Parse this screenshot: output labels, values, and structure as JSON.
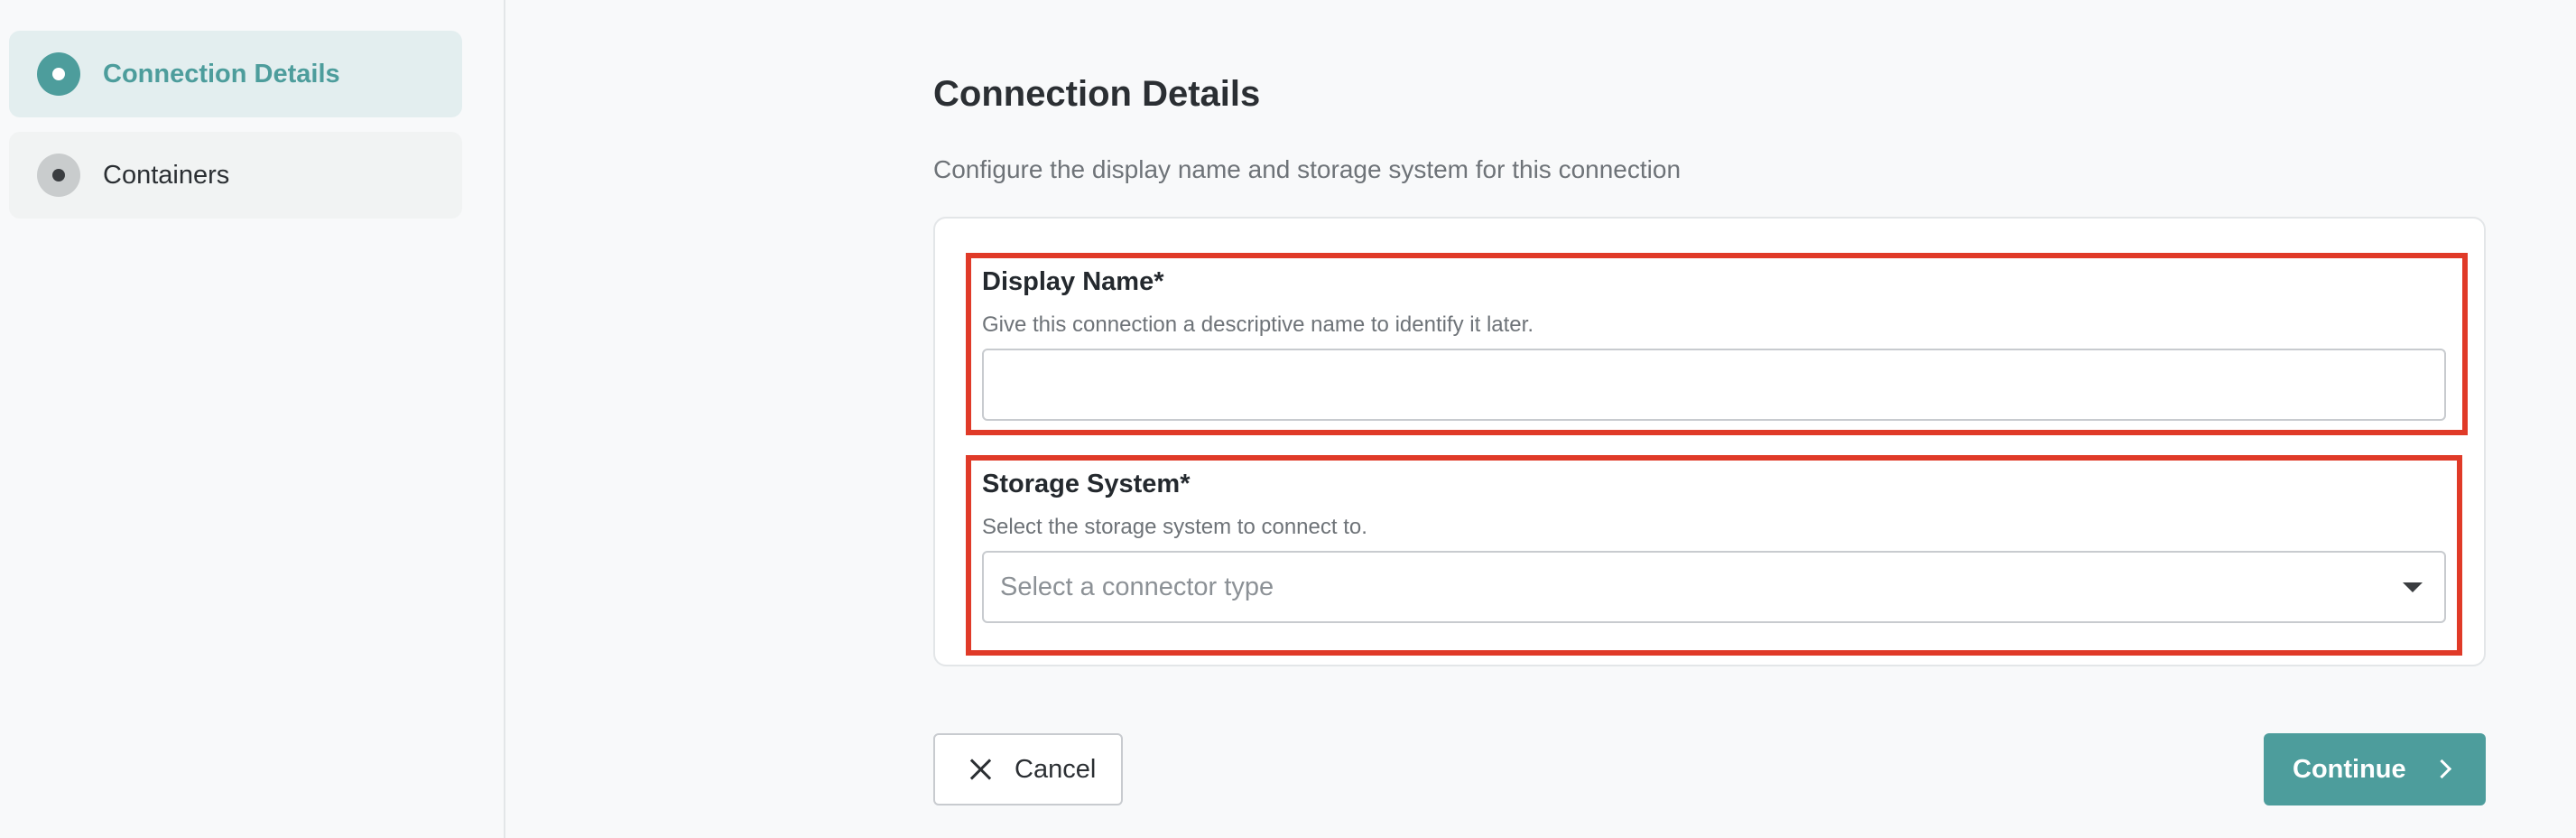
{
  "sidebar": {
    "steps": [
      {
        "label": "Connection Details",
        "state": "active"
      },
      {
        "label": "Containers",
        "state": "inactive"
      }
    ]
  },
  "main": {
    "title": "Connection Details",
    "subtitle": "Configure the display name and storage system for this connection",
    "display_name": {
      "label": "Display Name*",
      "help": "Give this connection a descriptive name to identify it later.",
      "value": ""
    },
    "storage_system": {
      "label": "Storage System*",
      "help": "Select the storage system to connect to.",
      "placeholder": "Select a connector type"
    }
  },
  "actions": {
    "cancel_label": "Cancel",
    "continue_label": "Continue"
  },
  "colors": {
    "accent": "#4d9d9c",
    "highlight_border": "#e03a28",
    "active_step_bg": "#e3eeef"
  },
  "icons": {
    "step_active": "radio-dot-icon",
    "step_inactive": "pending-dot-icon",
    "cancel": "close-icon",
    "continue": "chevron-right-icon",
    "select": "chevron-down-icon"
  }
}
